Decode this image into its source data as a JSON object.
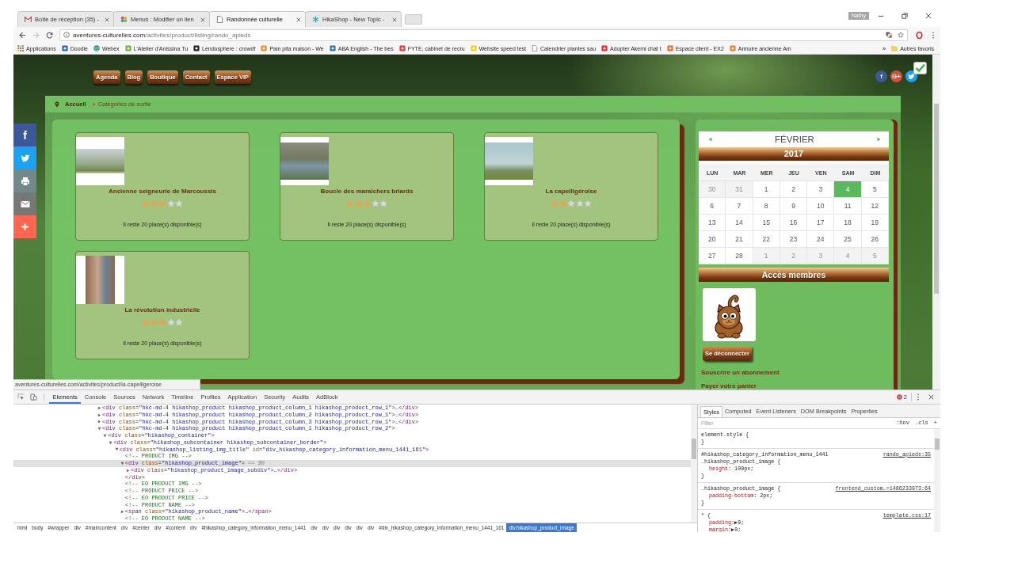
{
  "browser": {
    "tabs": [
      {
        "title": "Boîte de réception (35) -",
        "selected": false
      },
      {
        "title": "Menus : Modifier un lien",
        "selected": false
      },
      {
        "title": "Randonnée culturelle",
        "selected": true
      },
      {
        "title": "HikaShop - New Topic -",
        "selected": false
      }
    ],
    "profile": "Nathy",
    "forward_disabled": true,
    "address": {
      "domain": "aventures-culturelles.com",
      "path": "/activites/product/listing/rando_apieds"
    },
    "bookmarks": [
      "Applications",
      "Doodle",
      "Webex",
      "L'Atelier d'Anissina Tu",
      "Lendosphere : crowdf",
      "Pain pita maison - We",
      "ABA English - The bes",
      "FYTE, cabinet de recru",
      "Website speed test",
      "Calendrier plantes sau",
      "Adopter Akemi chat t",
      "Espace client - EX2",
      "Armoire ancienne Am"
    ],
    "bookmarks_more": "»",
    "other_bookmarks": "Autres favoris"
  },
  "page": {
    "nav": [
      "Agenda",
      "Blog",
      "Boutique",
      "Contact",
      "Espace VIP"
    ],
    "social_links": [
      {
        "kind": "facebook",
        "glyph": "f"
      },
      {
        "kind": "google",
        "glyph": "G+"
      },
      {
        "kind": "twitter"
      }
    ],
    "breadcrumb": {
      "home": "Accueil",
      "current": "Catégories de sortie"
    },
    "share_bar": [
      {
        "kind": "facebook",
        "glyph": "f"
      },
      {
        "kind": "twitter"
      },
      {
        "kind": "print"
      },
      {
        "kind": "mail"
      },
      {
        "kind": "more"
      }
    ],
    "products": [
      {
        "name": "Ancienne seigneurie de Marcoussis",
        "stars": 3,
        "availability": "Il reste 20 place(s) disponible(s)"
      },
      {
        "name": "Boucle des maraichers briards",
        "stars": 3,
        "availability": "Il reste 20 place(s) disponible(s)"
      },
      {
        "name": "La capelligéroise",
        "stars": 2,
        "availability": "Il reste 20 place(s) disponible(s)"
      },
      {
        "name": "La révolution industrielle",
        "stars": 3,
        "availability": "Il reste 20 place(s) disponible(s)"
      }
    ],
    "calendar": {
      "month": "FÉVRIER",
      "year": "2017",
      "weekdays": [
        "LUN",
        "MAR",
        "MER",
        "JEU",
        "VEN",
        "SAM",
        "DIM"
      ],
      "weeks": [
        {
          "days": [
            {
              "day": "30",
              "outside_month": true,
              "selected": false
            },
            {
              "day": "31",
              "outside_month": true,
              "selected": false
            },
            {
              "day": "1",
              "outside_month": false,
              "selected": false
            },
            {
              "day": "2",
              "outside_month": false,
              "selected": false
            },
            {
              "day": "3",
              "outside_month": false,
              "selected": false
            },
            {
              "day": "4",
              "outside_month": false,
              "selected": true
            },
            {
              "day": "5",
              "outside_month": false,
              "selected": false
            }
          ]
        },
        {
          "days": [
            {
              "day": "6",
              "outside_month": false,
              "selected": false
            },
            {
              "day": "7",
              "outside_month": false,
              "selected": false
            },
            {
              "day": "8",
              "outside_month": false,
              "selected": false
            },
            {
              "day": "9",
              "outside_month": false,
              "selected": false
            },
            {
              "day": "10",
              "outside_month": false,
              "selected": false
            },
            {
              "day": "11",
              "outside_month": false,
              "selected": false
            },
            {
              "day": "12",
              "outside_month": false,
              "selected": false
            }
          ]
        },
        {
          "days": [
            {
              "day": "13",
              "outside_month": false,
              "selected": false
            },
            {
              "day": "14",
              "outside_month": false,
              "selected": false
            },
            {
              "day": "15",
              "outside_month": false,
              "selected": false
            },
            {
              "day": "16",
              "outside_month": false,
              "selected": false
            },
            {
              "day": "17",
              "outside_month": false,
              "selected": false
            },
            {
              "day": "18",
              "outside_month": false,
              "selected": false
            },
            {
              "day": "19",
              "outside_month": false,
              "selected": false
            }
          ]
        },
        {
          "days": [
            {
              "day": "20",
              "outside_month": false,
              "selected": false
            },
            {
              "day": "21",
              "outside_month": false,
              "selected": false
            },
            {
              "day": "22",
              "outside_month": false,
              "selected": false
            },
            {
              "day": "23",
              "outside_month": false,
              "selected": false
            },
            {
              "day": "24",
              "outside_month": false,
              "selected": false
            },
            {
              "day": "25",
              "outside_month": false,
              "selected": false
            },
            {
              "day": "26",
              "outside_month": false,
              "selected": false
            }
          ]
        },
        {
          "days": [
            {
              "day": "27",
              "outside_month": false,
              "selected": false
            },
            {
              "day": "28",
              "outside_month": false,
              "selected": false
            },
            {
              "day": "1",
              "outside_month": true,
              "selected": false
            },
            {
              "day": "2",
              "outside_month": true,
              "selected": false
            },
            {
              "day": "3",
              "outside_month": true,
              "selected": false
            },
            {
              "day": "4",
              "outside_month": true,
              "selected": false
            },
            {
              "day": "5",
              "outside_month": true,
              "selected": false
            }
          ]
        }
      ]
    },
    "members": {
      "title": "Accès membres",
      "logout": "Se déconnecter",
      "links": [
        "Souscrire un abonnement",
        "Payer votre panier"
      ]
    },
    "status_url": "aventures-culturelles.com/activites/product/la-capelligeroise"
  },
  "devtools": {
    "tabs": [
      {
        "label": "Elements",
        "selected": true
      },
      {
        "label": "Console",
        "selected": false
      },
      {
        "label": "Sources",
        "selected": false
      },
      {
        "label": "Network",
        "selected": false
      },
      {
        "label": "Timeline",
        "selected": false
      },
      {
        "label": "Profiles",
        "selected": false
      },
      {
        "label": "Application",
        "selected": false
      },
      {
        "label": "Security",
        "selected": false
      },
      {
        "label": "Audits",
        "selected": false
      },
      {
        "label": "AdBlock",
        "selected": false
      }
    ],
    "error_count": "2",
    "dom_tree": [
      {
        "kind": "element",
        "code": "<div class=\"hkc-md-4 hikashop_product hikashop_product_column_1 hikashop_product_row_1\">…</div>",
        "expanded": false,
        "selected": false
      },
      {
        "kind": "element",
        "code": "<div class=\"hkc-md-4 hikashop_product hikashop_product_column_2 hikashop_product_row_1\">…</div>",
        "expanded": false,
        "selected": false
      },
      {
        "kind": "element",
        "code": "<div class=\"hkc-md-4 hikashop_product hikashop_product_column_3 hikashop_product_row_1\">…</div>",
        "expanded": false,
        "selected": false
      },
      {
        "kind": "element",
        "code": "<div class=\"hkc-md-4 hikashop_product hikashop_product_column_1 hikashop_product_row_2\">",
        "expanded": true,
        "selected": false,
        "children": [
          {
            "kind": "element",
            "code": "<div class=\"hikashop_container\">",
            "expanded": true,
            "selected": false,
            "children": [
              {
                "kind": "element",
                "code": "<div class=\"hikashop_subcontainer hikashop_subcontainer_border\">",
                "expanded": true,
                "selected": false,
                "children": [
                  {
                    "kind": "element",
                    "code": "<div class=\"hikashop_listing_img_title\" id=\"div_hikashop_category_information_menu_1441_161\">",
                    "expanded": true,
                    "selected": false,
                    "children": [
                      {
                        "kind": "comment",
                        "code": "<!-- PRODUCT IMG -->",
                        "selected": false
                      },
                      {
                        "kind": "element",
                        "code": "<div class=\"hikashop_product_image\">",
                        "expanded": true,
                        "selected": true,
                        "suffix": "== $0",
                        "closing": "</div>",
                        "children": [
                          {
                            "kind": "element",
                            "code": "<div class=\"hikashop_product_image_subdiv\">…</div>",
                            "expanded": false,
                            "selected": false
                          }
                        ]
                      },
                      {
                        "kind": "comment",
                        "code": "<!-- EO PRODUCT IMG -->",
                        "selected": false
                      },
                      {
                        "kind": "comment",
                        "code": "<!-- PRODUCT PRICE -->",
                        "selected": false
                      },
                      {
                        "kind": "comment",
                        "code": "<!-- EO PRODUCT PRICE -->",
                        "selected": false
                      },
                      {
                        "kind": "comment",
                        "code": "<!-- PRODUCT NAME -->",
                        "selected": false
                      },
                      {
                        "kind": "element",
                        "code": "<span class=\"hikashop_product_name\">…</span>",
                        "expanded": false,
                        "selected": false
                      },
                      {
                        "kind": "comment",
                        "code": "<!-- EO PRODUCT NAME -->",
                        "selected": false
                      }
                    ]
                  }
                ]
              }
            ]
          }
        ]
      }
    ],
    "breadcrumbs": [
      {
        "label": "html",
        "selected": false
      },
      {
        "label": "body",
        "selected": false
      },
      {
        "label": "#wrapper",
        "selected": false
      },
      {
        "label": "div",
        "selected": false
      },
      {
        "label": "#maincontent",
        "selected": false
      },
      {
        "label": "div",
        "selected": false
      },
      {
        "label": "#center",
        "selected": false
      },
      {
        "label": "div",
        "selected": false
      },
      {
        "label": "#content",
        "selected": false
      },
      {
        "label": "div",
        "selected": false
      },
      {
        "label": "#hikashop_category_information_menu_1441",
        "selected": false
      },
      {
        "label": "div",
        "selected": false
      },
      {
        "label": "div",
        "selected": false
      },
      {
        "label": "div",
        "selected": false
      },
      {
        "label": "div",
        "selected": false
      },
      {
        "label": "div",
        "selected": false
      },
      {
        "label": "div",
        "selected": false
      },
      {
        "label": "#div_hikashop_category_information_menu_1441_161",
        "selected": false
      },
      {
        "label": "div.hikashop_product_image",
        "selected": true
      }
    ],
    "styles_tabs": [
      {
        "label": "Styles",
        "selected": true
      },
      {
        "label": "Computed",
        "selected": false
      },
      {
        "label": "Event Listeners",
        "selected": false
      },
      {
        "label": "DOM Breakpoints",
        "selected": false
      },
      {
        "label": "Properties",
        "selected": false
      }
    ],
    "filter_placeholder": "Filter",
    "style_buttons": [
      ":hov",
      ".cls",
      "+"
    ],
    "rules": [
      {
        "selector_lines": [
          "element.style {"
        ],
        "close": "}"
      },
      {
        "selector_lines": [
          "#hikashop_category_information_menu_1441",
          ".hikashop_product_image {"
        ],
        "source": "rando_apieds:35",
        "declarations": [
          "height: 100px;"
        ],
        "close": "}"
      },
      {
        "selector_lines": [
          ".hikashop_product_image {"
        ],
        "source": "frontend_custom…=1486233973:64",
        "declarations": [
          "padding-bottom: 2px;"
        ],
        "close": "}"
      },
      {
        "selector_lines": [
          "* {"
        ],
        "source": "template.css:17",
        "declarations": [
          "padding:▶0;",
          "margin:▶0;"
        ]
      }
    ]
  }
}
